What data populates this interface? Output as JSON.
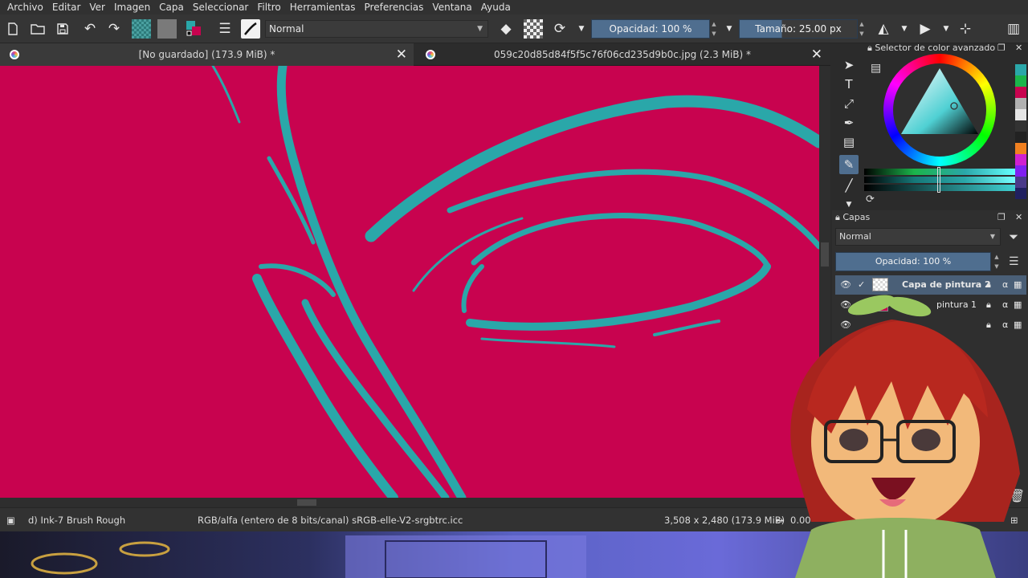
{
  "menu": [
    "Archivo",
    "Editar",
    "Ver",
    "Imagen",
    "Capa",
    "Seleccionar",
    "Filtro",
    "Herramientas",
    "Preferencias",
    "Ventana",
    "Ayuda"
  ],
  "toolbar": {
    "blend_mode": "Normal",
    "opacity_label": "Opacidad: 100 %",
    "size_label": "Tamaño: 25.00 px"
  },
  "tabs": [
    {
      "label": "[No guardado]  (173.9 MiB) *",
      "close": "✕"
    },
    {
      "label": "059c20d85d84f5f5c76f06cd235d9b0c.jpg (2.3 MiB) *",
      "close": "✕"
    }
  ],
  "color_docker": {
    "title": "Selector de color avanzado"
  },
  "layers_docker": {
    "title": "Capas",
    "blend_mode": "Normal",
    "opacity_label": "Opacidad: 100 %",
    "layers": [
      {
        "name": "Capa de pintura 2",
        "thumb_color": "#f2f2f2"
      },
      {
        "name": "pintura 1",
        "thumb_color": "#c8034f"
      },
      {
        "name": "",
        "thumb_color": "#2f2f2f"
      }
    ]
  },
  "status": {
    "brush": "d) Ink-7 Brush Rough",
    "color_space": "RGB/alfa (entero de 8 bits/canal)  sRGB-elle-V2-srgbtrc.icc",
    "dimensions": "3,508 x 2,480 (173.9 MiB)",
    "rotation": "0.00°"
  },
  "colors": {
    "canvas": "#c8034f",
    "stroke": "#2aa7a9",
    "accent": "#4f6e8f"
  }
}
